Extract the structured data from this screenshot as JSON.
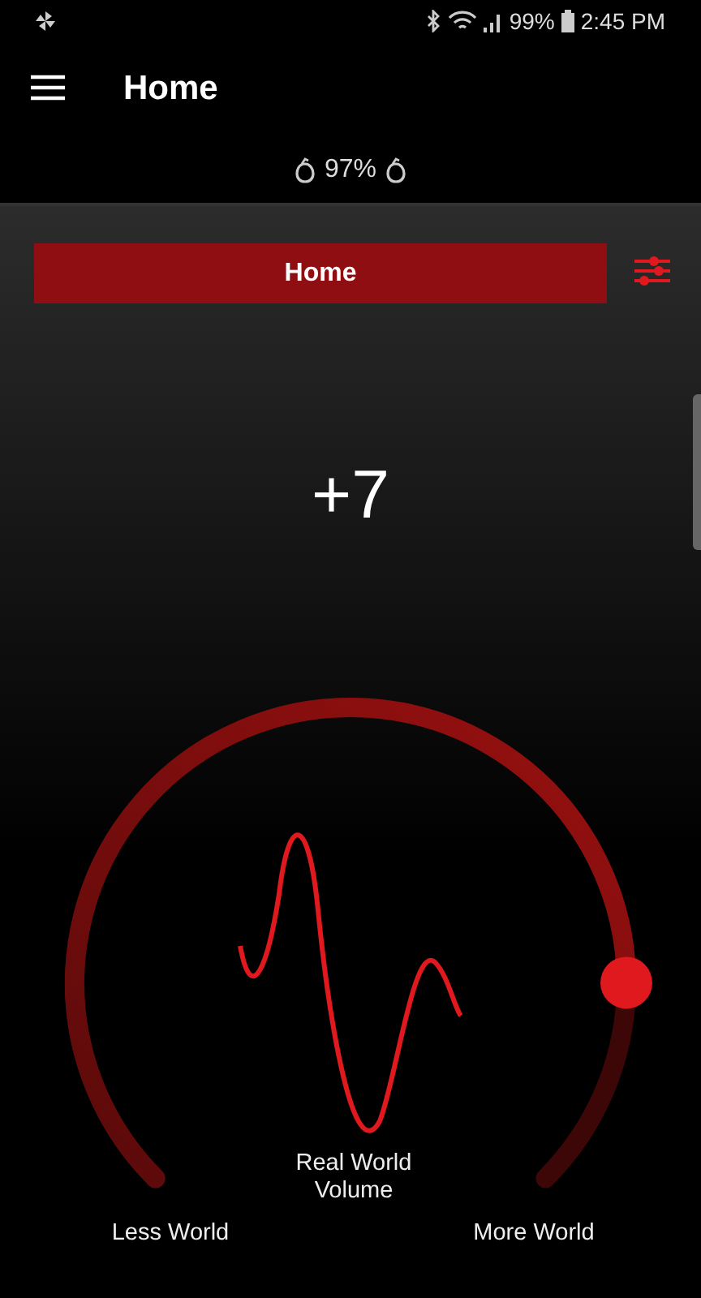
{
  "status_bar": {
    "battery": "99%",
    "time": "2:45 PM"
  },
  "app_bar": {
    "title": "Home"
  },
  "earbuds": {
    "battery": "97%"
  },
  "preset": {
    "label": "Home"
  },
  "volume": {
    "value": "+7"
  },
  "dial_labels": {
    "center": "Real World Volume",
    "left": "Less World",
    "right": "More World"
  }
}
